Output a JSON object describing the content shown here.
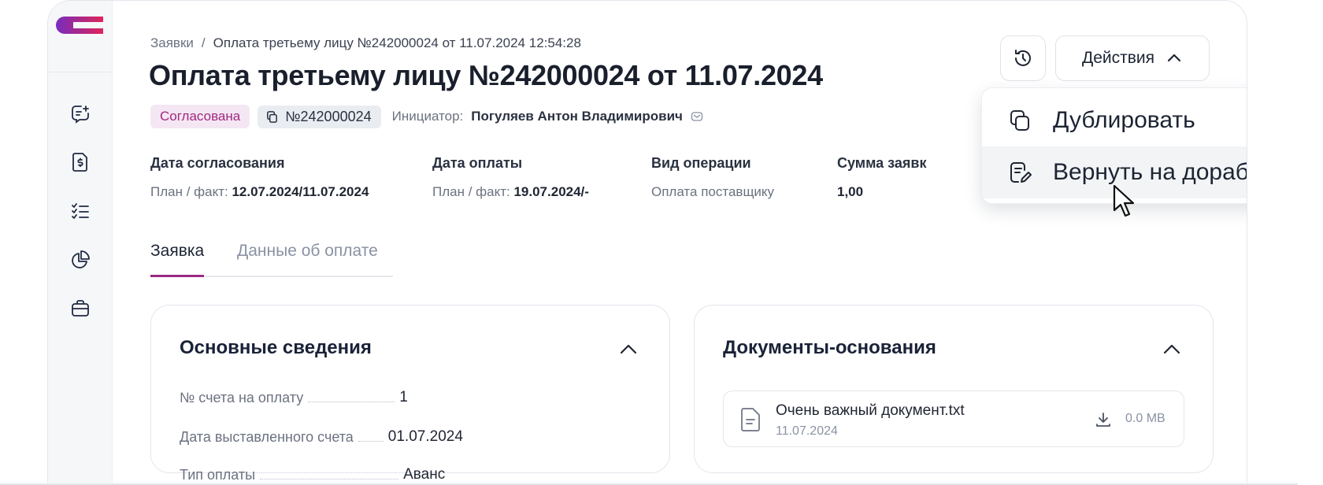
{
  "breadcrumb": {
    "root": "Заявки",
    "separator": "/",
    "current": "Оплата третьему лицу №242000024 от 11.07.2024 12:54:28"
  },
  "title": "Оплата третьему лицу №242000024 от 11.07.2024",
  "status_badge": "Согласована",
  "number_badge": "№242000024",
  "initiator": {
    "label": "Инициатор:",
    "name": "Погуляев Антон Владимирович"
  },
  "info": [
    {
      "label": "Дата согласования",
      "prefix": "План / факт:",
      "value": "12.07.2024/11.07.2024"
    },
    {
      "label": "Дата оплаты",
      "prefix": "План / факт:",
      "value": "19.07.2024/-"
    },
    {
      "label": "Вид операции",
      "prefix": "",
      "value": "Оплата поставщику"
    },
    {
      "label": "Сумма заявк",
      "prefix": "",
      "value": "1,00"
    }
  ],
  "tabs": [
    {
      "label": "Заявка",
      "active": true
    },
    {
      "label": "Данные об оплате",
      "active": false
    }
  ],
  "main_card": {
    "title": "Основные сведения",
    "fields": [
      {
        "label": "№ счета на оплату",
        "value": "1"
      },
      {
        "label": "Дата выставленного счета",
        "value": "01.07.2024"
      },
      {
        "label": "Тип оплаты",
        "value": "Аванс"
      }
    ]
  },
  "docs_card": {
    "title": "Документы-основания",
    "document": {
      "name": "Очень важный документ.txt",
      "date": "11.07.2024",
      "size": "0.0 MB"
    }
  },
  "toolbar": {
    "actions_label": "Действия"
  },
  "dropdown": {
    "items": [
      {
        "label": "Дублировать",
        "icon": "duplicate-icon"
      },
      {
        "label": "Вернуть на доработку",
        "icon": "return-edit-icon"
      }
    ]
  },
  "colors": {
    "accent": "#9a2a83",
    "status_bg": "#f4e7f3",
    "status_text": "#a0287f",
    "logo_gradient": [
      "#7a2cbf",
      "#d6246b"
    ]
  },
  "sidebar_icons": [
    "add-request-icon",
    "payment-document-icon",
    "checklist-icon",
    "pie-chart-icon",
    "briefcase-icon"
  ]
}
